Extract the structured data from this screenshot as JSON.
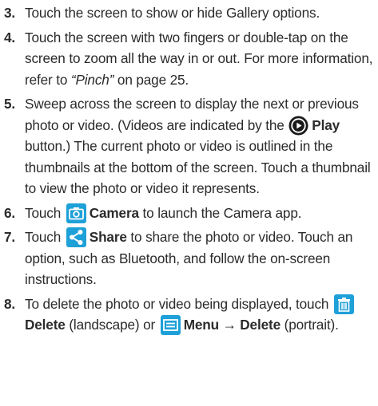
{
  "steps": [
    {
      "num": "3.",
      "text": "Touch the screen to show or hide Gallery options."
    },
    {
      "num": "4.",
      "text_a": "Touch the screen with two fingers or double-tap on the screen to zoom all the way in or out. For more information, refer to ",
      "ref": "“Pinch”",
      "text_b": " on page 25."
    },
    {
      "num": "5.",
      "text_a": "Sweep across the screen to display the next or previous photo or video. (Videos are indicated by the ",
      "play_label": "Play",
      "text_b": " button.) The current photo or video is outlined in the thumbnails at the bottom of the screen. Touch a thumbnail to view the photo or video it represents."
    },
    {
      "num": "6.",
      "text_a": "Touch ",
      "camera_label": "Camera",
      "text_b": " to launch the Camera app."
    },
    {
      "num": "7.",
      "text_a": "Touch ",
      "share_label": "Share",
      "text_b": " to share the photo or video. Touch an option, such as Bluetooth, and follow the on-screen instructions."
    },
    {
      "num": "8.",
      "text_a": "To delete the photo or video being displayed, touch ",
      "delete_label": "Delete",
      "text_b": " (landscape) or ",
      "menu_label": "Menu",
      "arrow": " → ",
      "delete_label_2": "Delete",
      "text_c": " (portrait)."
    }
  ],
  "colors": {
    "icon_bg": "#1ea0d8",
    "play_bg": "#1a1a1a"
  },
  "icons": {
    "play": "play-icon",
    "camera": "camera-icon",
    "share": "share-icon",
    "delete": "trash-icon",
    "menu": "menu-icon"
  }
}
